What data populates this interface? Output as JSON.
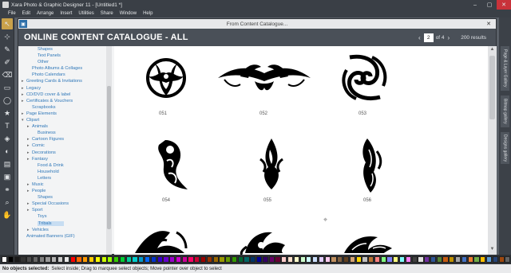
{
  "window": {
    "title": "Xara Photo & Graphic Designer 11 - [Untitled1 *]"
  },
  "menu": [
    "File",
    "Edit",
    "Arrange",
    "Insert",
    "Utilities",
    "Share",
    "Window",
    "Help"
  ],
  "toolbar": {
    "tools": [
      {
        "icon": "selector-icon",
        "glyph": "↖",
        "active": true
      },
      {
        "icon": "contour-icon",
        "glyph": "⊹"
      },
      {
        "icon": "pen-icon",
        "glyph": "✎"
      },
      {
        "icon": "freehand-icon",
        "glyph": "✐"
      },
      {
        "icon": "eraser-icon",
        "glyph": "⌫"
      },
      {
        "icon": "rectangle-icon",
        "glyph": "▭"
      },
      {
        "icon": "ellipse-icon",
        "glyph": "◯"
      },
      {
        "icon": "star-icon",
        "glyph": "★"
      },
      {
        "icon": "text-icon",
        "glyph": "T"
      },
      {
        "icon": "fill-icon",
        "glyph": "◈"
      },
      {
        "icon": "transparency-icon",
        "glyph": "◐"
      },
      {
        "icon": "shadow-icon",
        "glyph": "▤"
      },
      {
        "icon": "mould-icon",
        "glyph": "▣"
      },
      {
        "icon": "blend-icon",
        "glyph": "⚭"
      },
      {
        "icon": "zoom-icon",
        "glyph": "⌕"
      },
      {
        "icon": "push-icon",
        "glyph": "✋"
      }
    ]
  },
  "dialog": {
    "title": "From Content Catalogue...",
    "catalogue_title": "ONLINE CONTENT CATALOGUE - ALL",
    "page": "2",
    "page_of": "of 4",
    "results": "200 results"
  },
  "tree": [
    {
      "label": "Shapes",
      "indent": 2
    },
    {
      "label": "Text Panels",
      "indent": 2
    },
    {
      "label": "Other",
      "indent": 2
    },
    {
      "label": "Photo Albums & Collages",
      "indent": 1
    },
    {
      "label": "Photo Calendars",
      "indent": 1
    },
    {
      "label": "Greeting Cards & Invitations",
      "indent": 0,
      "tw": "▸"
    },
    {
      "label": "Legacy",
      "indent": 0,
      "tw": "▸"
    },
    {
      "label": "CD/DVD cover & label",
      "indent": 0,
      "tw": "▸"
    },
    {
      "label": "Certificates & Vouchers",
      "indent": 0,
      "tw": "▸"
    },
    {
      "label": "Scrapbooks",
      "indent": 1
    },
    {
      "label": "Page Elements",
      "indent": 0,
      "tw": "▸"
    },
    {
      "label": "Clipart",
      "indent": 0,
      "tw": "▾"
    },
    {
      "label": "Animals",
      "indent": 1,
      "tw": "▸"
    },
    {
      "label": "Business",
      "indent": 2
    },
    {
      "label": "Cartoon Figures",
      "indent": 1,
      "tw": "▸"
    },
    {
      "label": "Comic",
      "indent": 1,
      "tw": "▸"
    },
    {
      "label": "Decorations",
      "indent": 1,
      "tw": "▸"
    },
    {
      "label": "Fantasy",
      "indent": 1,
      "tw": "▸"
    },
    {
      "label": "Food & Drink",
      "indent": 2
    },
    {
      "label": "Household",
      "indent": 2
    },
    {
      "label": "Letters",
      "indent": 2
    },
    {
      "label": "Music",
      "indent": 1,
      "tw": "▸"
    },
    {
      "label": "People",
      "indent": 1,
      "tw": "▸"
    },
    {
      "label": "Shapes",
      "indent": 2
    },
    {
      "label": "Special Occasions",
      "indent": 1,
      "tw": "▸"
    },
    {
      "label": "Sport",
      "indent": 1,
      "tw": "▸"
    },
    {
      "label": "Toys",
      "indent": 2
    },
    {
      "label": "Tribals",
      "indent": 2,
      "selected": true
    },
    {
      "label": "Vehicles",
      "indent": 1,
      "tw": "▸"
    },
    {
      "label": "Animated Banners (GIF)",
      "indent": 0
    }
  ],
  "gallery": {
    "items": [
      {
        "label": "051",
        "shape": "sun"
      },
      {
        "label": "052",
        "shape": "band"
      },
      {
        "label": "053",
        "shape": "swirl"
      },
      {
        "label": "054",
        "shape": "curl"
      },
      {
        "label": "055",
        "shape": "flame"
      },
      {
        "label": "056",
        "shape": "blade"
      }
    ]
  },
  "sidetabs": [
    "Page & Layer Gallery",
    "Bitmap gallery",
    "Designs gallery"
  ],
  "palette": [
    "#ffffff",
    "#000000",
    "#1a1a1a",
    "#333333",
    "#4d4d4d",
    "#666666",
    "#808080",
    "#999999",
    "#b3b3b3",
    "#cccccc",
    "#e6e6e6",
    "#ff0000",
    "#ff6600",
    "#ff9900",
    "#ffcc00",
    "#ffff00",
    "#ccff00",
    "#99ff00",
    "#33cc00",
    "#00cc33",
    "#00cc99",
    "#00cccc",
    "#0099cc",
    "#0066ff",
    "#0033cc",
    "#3300cc",
    "#6600cc",
    "#9900cc",
    "#cc00cc",
    "#cc0099",
    "#ff0066",
    "#cc0033",
    "#990000",
    "#993300",
    "#996600",
    "#999900",
    "#669900",
    "#339900",
    "#006633",
    "#006666",
    "#003366",
    "#000099",
    "#330066",
    "#660066",
    "#660033",
    "#ffcccc",
    "#ffe0cc",
    "#ffffcc",
    "#ccffcc",
    "#ccffff",
    "#cce0ff",
    "#e0ccff",
    "#ffccf0",
    "#c09060",
    "#806040",
    "#604020",
    "#d4a373",
    "#ffd700",
    "#c0c0c0",
    "#b87333",
    "#ff8080",
    "#80ff80",
    "#8080ff",
    "#ffff80",
    "#80ffff",
    "#ff80ff",
    "#404040",
    "#e0e0e0",
    "#7030a0",
    "#2f5597",
    "#548235",
    "#c55a11",
    "#bf9000",
    "#a5a5a5",
    "#4472c4",
    "#ed7d31",
    "#70ad47",
    "#ffc000",
    "#5b9bd5",
    "#264478",
    "#9e480e",
    "#636363"
  ],
  "status": {
    "bold": "No objects selected:",
    "text": "Select inside; Drag to marquee select objects; Move pointer over object to select"
  }
}
